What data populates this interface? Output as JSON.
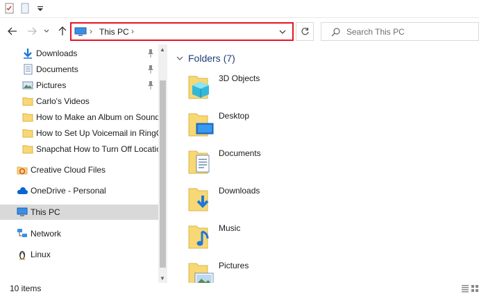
{
  "toolbar": {
    "quick_access": [
      "properties-icon",
      "new-folder-icon",
      "customize-dropdown-icon"
    ]
  },
  "address_bar": {
    "location_icon": "this-pc-icon",
    "breadcrumb": "This PC"
  },
  "search": {
    "placeholder": "Search This PC"
  },
  "navigation": {
    "items": [
      {
        "label": "Downloads",
        "icon": "download-arrow-icon",
        "pinned": true
      },
      {
        "label": "Documents",
        "icon": "documents-icon",
        "pinned": true
      },
      {
        "label": "Pictures",
        "icon": "pictures-icon",
        "pinned": true
      },
      {
        "label": "Carlo's Videos",
        "icon": "folder-icon",
        "pinned": false
      },
      {
        "label": "How to Make an Album on SoundC",
        "icon": "folder-icon",
        "pinned": false
      },
      {
        "label": "How to Set Up Voicemail in RingCe",
        "icon": "folder-icon",
        "pinned": false
      },
      {
        "label": "Snapchat How to Turn Off Location",
        "icon": "folder-icon",
        "pinned": false
      },
      {
        "label": "Creative Cloud Files",
        "icon": "creative-cloud-icon",
        "pinned": false
      },
      {
        "label": "OneDrive - Personal",
        "icon": "onedrive-cloud-icon",
        "pinned": false
      },
      {
        "label": "This PC",
        "icon": "this-pc-icon",
        "pinned": false,
        "selected": true
      },
      {
        "label": "Network",
        "icon": "network-icon",
        "pinned": false
      },
      {
        "label": "Linux",
        "icon": "linux-penguin-icon",
        "pinned": false
      }
    ]
  },
  "content": {
    "group_title": "Folders",
    "group_count": "(7)",
    "folders": [
      {
        "name": "3D Objects",
        "icon": "3d-objects-folder-icon"
      },
      {
        "name": "Desktop",
        "icon": "desktop-folder-icon"
      },
      {
        "name": "Documents",
        "icon": "documents-folder-icon"
      },
      {
        "name": "Downloads",
        "icon": "downloads-folder-icon"
      },
      {
        "name": "Music",
        "icon": "music-folder-icon"
      },
      {
        "name": "Pictures",
        "icon": "pictures-folder-icon"
      }
    ]
  },
  "status_bar": {
    "item_count": "10 items"
  },
  "colors": {
    "address_highlight": "#e81123",
    "folder_yellow": "#f8d775",
    "accent_blue": "#1e78d7",
    "group_header": "#1e3c78",
    "selected_row": "#d9d9d9"
  }
}
